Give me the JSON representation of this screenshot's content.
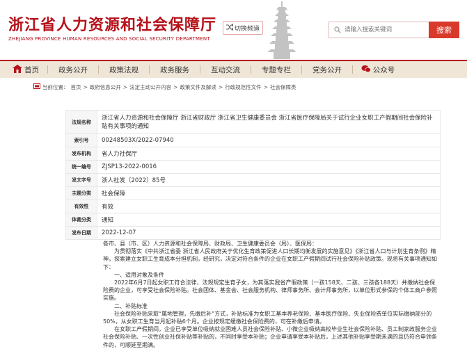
{
  "header": {
    "title": "浙江省人力资源和社会保障厅",
    "subtitle": "ZHEJIANG PROVINCE HUMAN RESOURCES AND SOCIAL SECURITY DEPARTMENT",
    "switch_label": "切换频道",
    "search_placeholder": "请输入搜索关键词",
    "search_button": "搜索"
  },
  "nav": [
    {
      "label": "首页",
      "icon": "home-icon"
    },
    {
      "label": "政务公开"
    },
    {
      "label": "政策法规"
    },
    {
      "label": "政务服务"
    },
    {
      "label": "互动交流"
    },
    {
      "label": "专题专栏"
    },
    {
      "label": "党务公开"
    },
    {
      "label": "公众号",
      "icon": "wechat-icon"
    }
  ],
  "breadcrumb": {
    "prefix": "当前位置：",
    "items": [
      "首页",
      "政府信息公开",
      "法定主动公开内容",
      "政策文件及解读",
      "行政规范性文件",
      "社会保障类"
    ],
    "separator": ">"
  },
  "info": [
    {
      "label": "法规名称",
      "value": "浙江省人力资源和社会保障厅 浙江省财政厅 浙江省卫生健康委员会 浙江省医疗保障局关于试行企业女职工产假期间社会保险补贴有关事项的通知"
    },
    {
      "label": "索引号",
      "value": "00248503X/2022-07940"
    },
    {
      "label": "发布机构",
      "value": "省人力社保厅"
    },
    {
      "label": "统一编号",
      "value": "ZJSP13-2022-0016"
    },
    {
      "label": "发文字号",
      "value": "浙人社发〔2022〕85号"
    },
    {
      "label": "主题分类",
      "value": "社会保障"
    },
    {
      "label": "有效性",
      "value": "有效"
    },
    {
      "label": "体裁分类",
      "value": "通知"
    },
    {
      "label": "发布日期",
      "value": "2022-12-07"
    }
  ],
  "content": {
    "greeting": "各市、县（市、区）人力资源和社会保障局、财政局、卫生健康委员会（局）、医保局：",
    "intro": "为贯彻落实《中共浙江省委 浙江省人民政府关于优化生育政策促进人口长期均衡发展的实施意见》《浙江省人口与计划生育条例》精神，探索建立女职工生育成本分担机制，经研究，决定对符合条件的企业在女职工产假期间试行社会保险补贴政策。现将有关事项通知如下：",
    "section1": "一、适用对象及条件",
    "para1": "2022年6月7日起女职工符合法律、法规规定生育子女，为其落实我省产假政策（一孩158天、二孩、三孩各188天）并缴纳社会保险费的企业，可享受社会保险补贴。社会团体、基金会、社会服务机构、律师事务所、会计师事务所，以单位形式参保的个体工商户参照实施。",
    "section2": "二、补贴标准",
    "para2": "社会保险补贴采取“属地管理，先缴后补”方式，补贴标准为女职工基本养老保险、基本医疗保险、失业保险费单位实际缴纳部分的50%，从女职工生育当月起补贴6个月。企业按规定缓缴社会保险费的，可在补缴后申请。",
    "para3": "在女职工产假期间，企业已享受单位吸纳就业困难人员社会保险补贴、小微企业吸纳高校毕业生社会保险补贴、员工制家政服务企业社会保险补贴、一次性创业社保补贴等补贴的，不同时享受本补贴；企业申请享受本补贴后，上述其他补贴享受期未满的且仍符合申领条件的，可顺延至期满。"
  }
}
